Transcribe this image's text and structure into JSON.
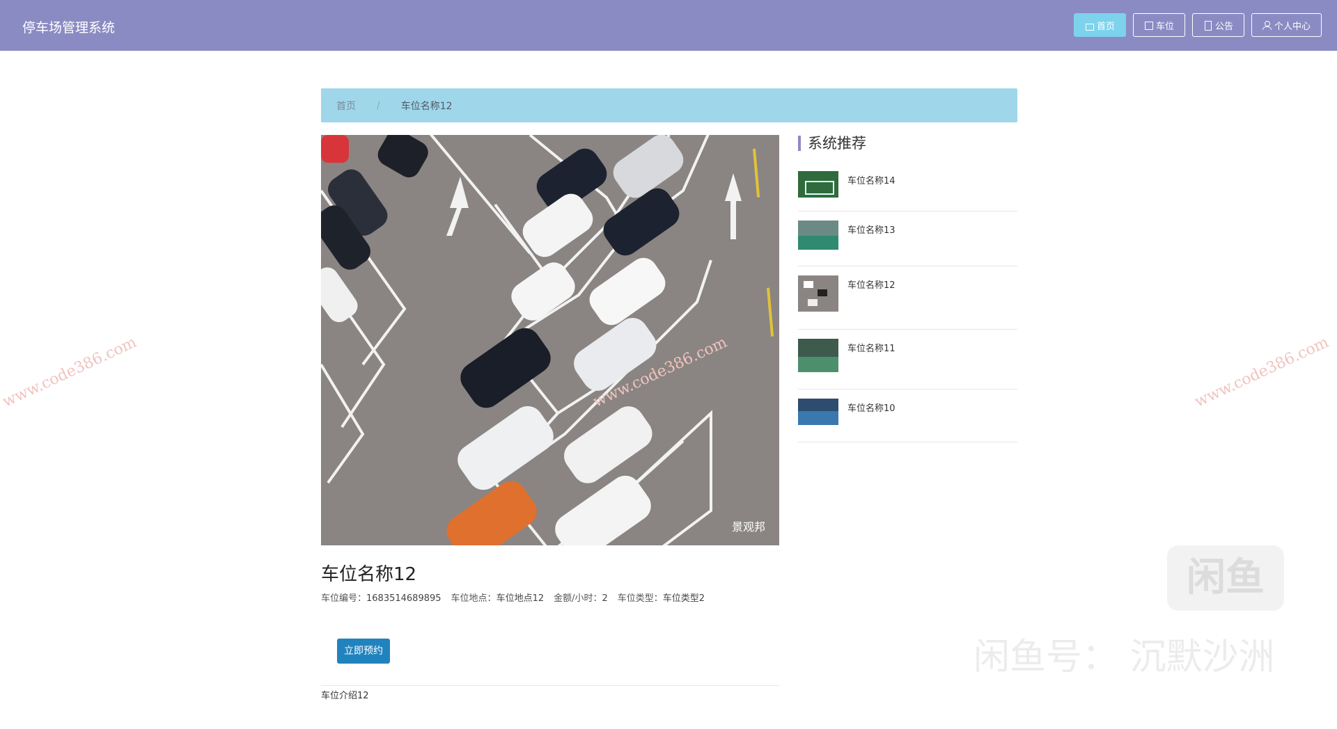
{
  "header": {
    "brand": "停车场管理系统",
    "nav": [
      {
        "label": "首页",
        "icon": "home-icon",
        "active": true
      },
      {
        "label": "车位",
        "icon": "grid-icon",
        "active": false
      },
      {
        "label": "公告",
        "icon": "notice-icon",
        "active": false
      },
      {
        "label": "个人中心",
        "icon": "user-icon",
        "active": false
      }
    ]
  },
  "breadcrumb": {
    "home": "首页",
    "separator": "/",
    "current": "车位名称12"
  },
  "detail": {
    "image_watermark": "景观邦",
    "title": "车位名称12",
    "meta": [
      {
        "label": "车位编号：",
        "value": "1683514689895"
      },
      {
        "label": "车位地点：",
        "value": "车位地点12"
      },
      {
        "label": "金额/小时：",
        "value": "2"
      },
      {
        "label": "车位类型：",
        "value": "车位类型2"
      }
    ],
    "reserve_button": "立即预约",
    "description": "车位介绍12"
  },
  "recommend": {
    "title": "系统推荐",
    "items": [
      {
        "name": "车位名称14"
      },
      {
        "name": "车位名称13"
      },
      {
        "name": "车位名称12"
      },
      {
        "name": "车位名称11"
      },
      {
        "name": "车位名称10"
      }
    ]
  },
  "overlay": {
    "watermark": "www.code386.com",
    "xianyu_logo": "闲鱼",
    "xianyu_text": "闲鱼号：  沉默沙洲"
  },
  "colors": {
    "header_bg": "#8b8bc4",
    "active_nav": "#7dd3ec",
    "breadcrumb_bg": "#9fd6ea",
    "button": "#2183bd"
  }
}
